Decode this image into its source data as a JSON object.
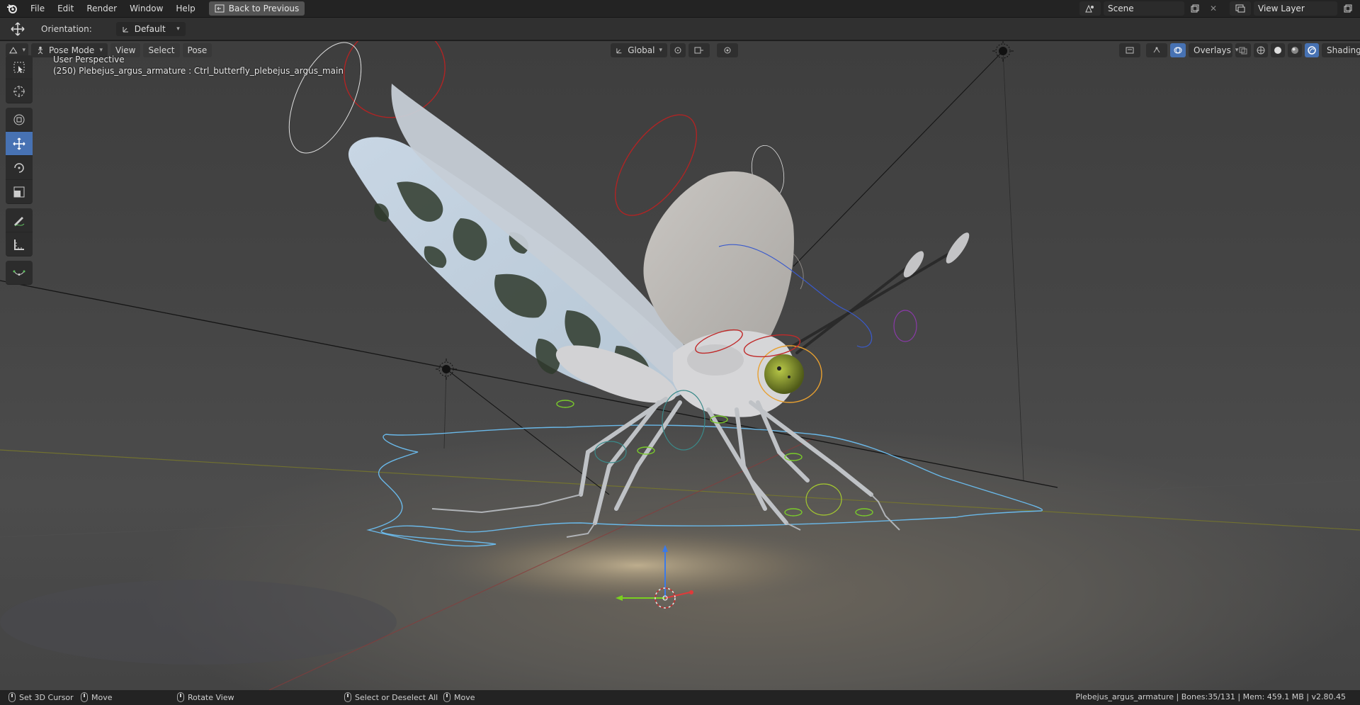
{
  "menu": {
    "items": [
      "File",
      "Edit",
      "Render",
      "Window",
      "Help"
    ],
    "back_button": "Back to Previous"
  },
  "scene_selector": {
    "value": "Scene"
  },
  "view_layer_selector": {
    "value": "View Layer"
  },
  "tool_settings": {
    "orientation_label": "Orientation:",
    "orientation_value": "Default"
  },
  "viewport_header": {
    "mode": "Pose Mode",
    "menus": [
      "View",
      "Select",
      "Pose"
    ],
    "transform_orientation": "Global",
    "overlays": "Overlays",
    "shading": "Shading"
  },
  "viewport_info": {
    "perspective": "User Perspective",
    "object_info": "(250) Plebejus_argus_armature : Ctrl_butterfly_plebejus_argus_main"
  },
  "toolbar": {
    "tools": [
      "select-box",
      "cursor",
      "transform",
      "move",
      "rotate",
      "scale",
      "annotate",
      "measure",
      "relax"
    ],
    "active": "move"
  },
  "status_bar": {
    "items": [
      {
        "icon": "mouse-left-icon",
        "label": "Set 3D Cursor"
      },
      {
        "icon": "mouse-middle-icon",
        "label": "Move"
      },
      {
        "icon": "mouse-middle-icon",
        "label": "Rotate View"
      },
      {
        "icon": "mouse-left-icon",
        "label": "Select or Deselect All"
      },
      {
        "icon": "mouse-left-icon",
        "label": "Move"
      }
    ],
    "stats": "Plebejus_argus_armature | Bones:35/131 | Mem: 459.1 MB | v2.80.45"
  },
  "colors": {
    "accent": "#4772b3",
    "header_bg": "#232323",
    "viewport_bg": "#454545",
    "rig_blue": "#6ab8e8",
    "rig_red": "#c22a2a",
    "rig_green": "#7acc2a"
  }
}
